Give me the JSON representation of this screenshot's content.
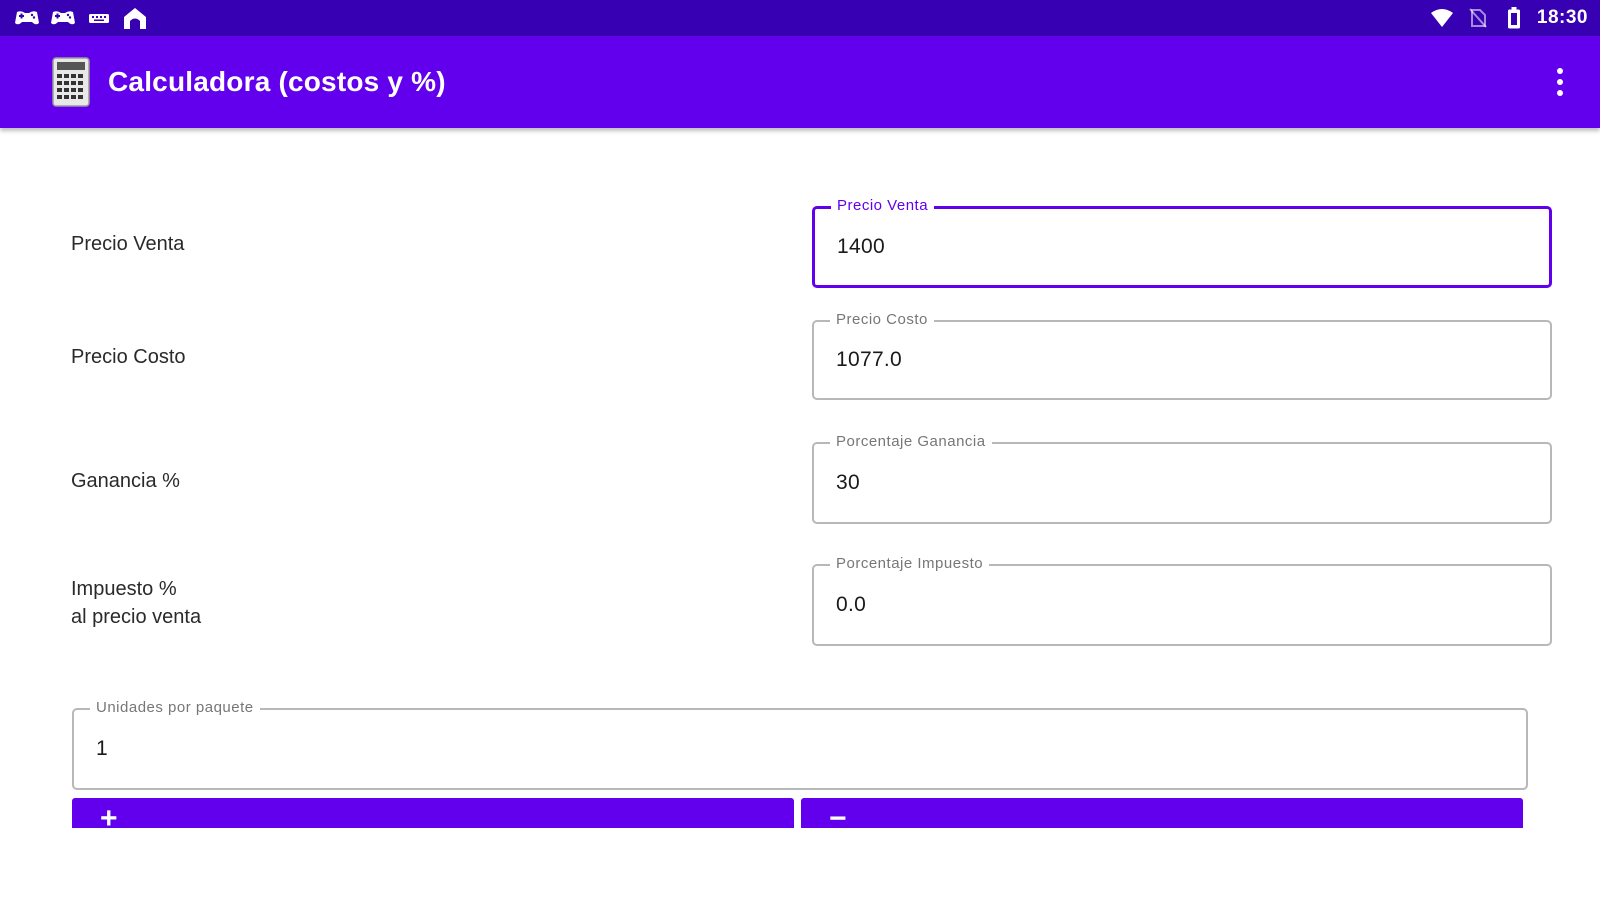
{
  "status_bar": {
    "left_icons": [
      "gamepad-icon",
      "gamepad-icon",
      "keyboard-icon",
      "home-icon"
    ],
    "right_icons": [
      "wifi-icon",
      "no-sim-icon",
      "battery-icon"
    ],
    "time": "18:30"
  },
  "app_bar": {
    "icon": "calculator-icon",
    "title": "Calculadora (costos y %)",
    "menu_icon": "overflow-menu-icon"
  },
  "form": {
    "rows": [
      {
        "label": "Precio Venta",
        "field_label": "Precio Venta",
        "value": "1400",
        "focused": true
      },
      {
        "label": "Precio Costo",
        "field_label": "Precio Costo",
        "value": "1077.0",
        "focused": false
      },
      {
        "label": "Ganancia %",
        "field_label": "Porcentaje Ganancia",
        "value": "30",
        "focused": false
      },
      {
        "label_line1": "Impuesto %",
        "label_line2": "al precio venta",
        "field_label": "Porcentaje Impuesto",
        "value": "0.0",
        "focused": false
      }
    ],
    "units": {
      "field_label": "Unidades por paquete",
      "value": "1"
    },
    "buttons": {
      "plus_label": "+",
      "minus_label": "−"
    }
  },
  "colors": {
    "status_bar": "#3700b3",
    "app_bar": "#6200ee",
    "accent": "#6200ee",
    "field_border": "#b8b8b8"
  }
}
